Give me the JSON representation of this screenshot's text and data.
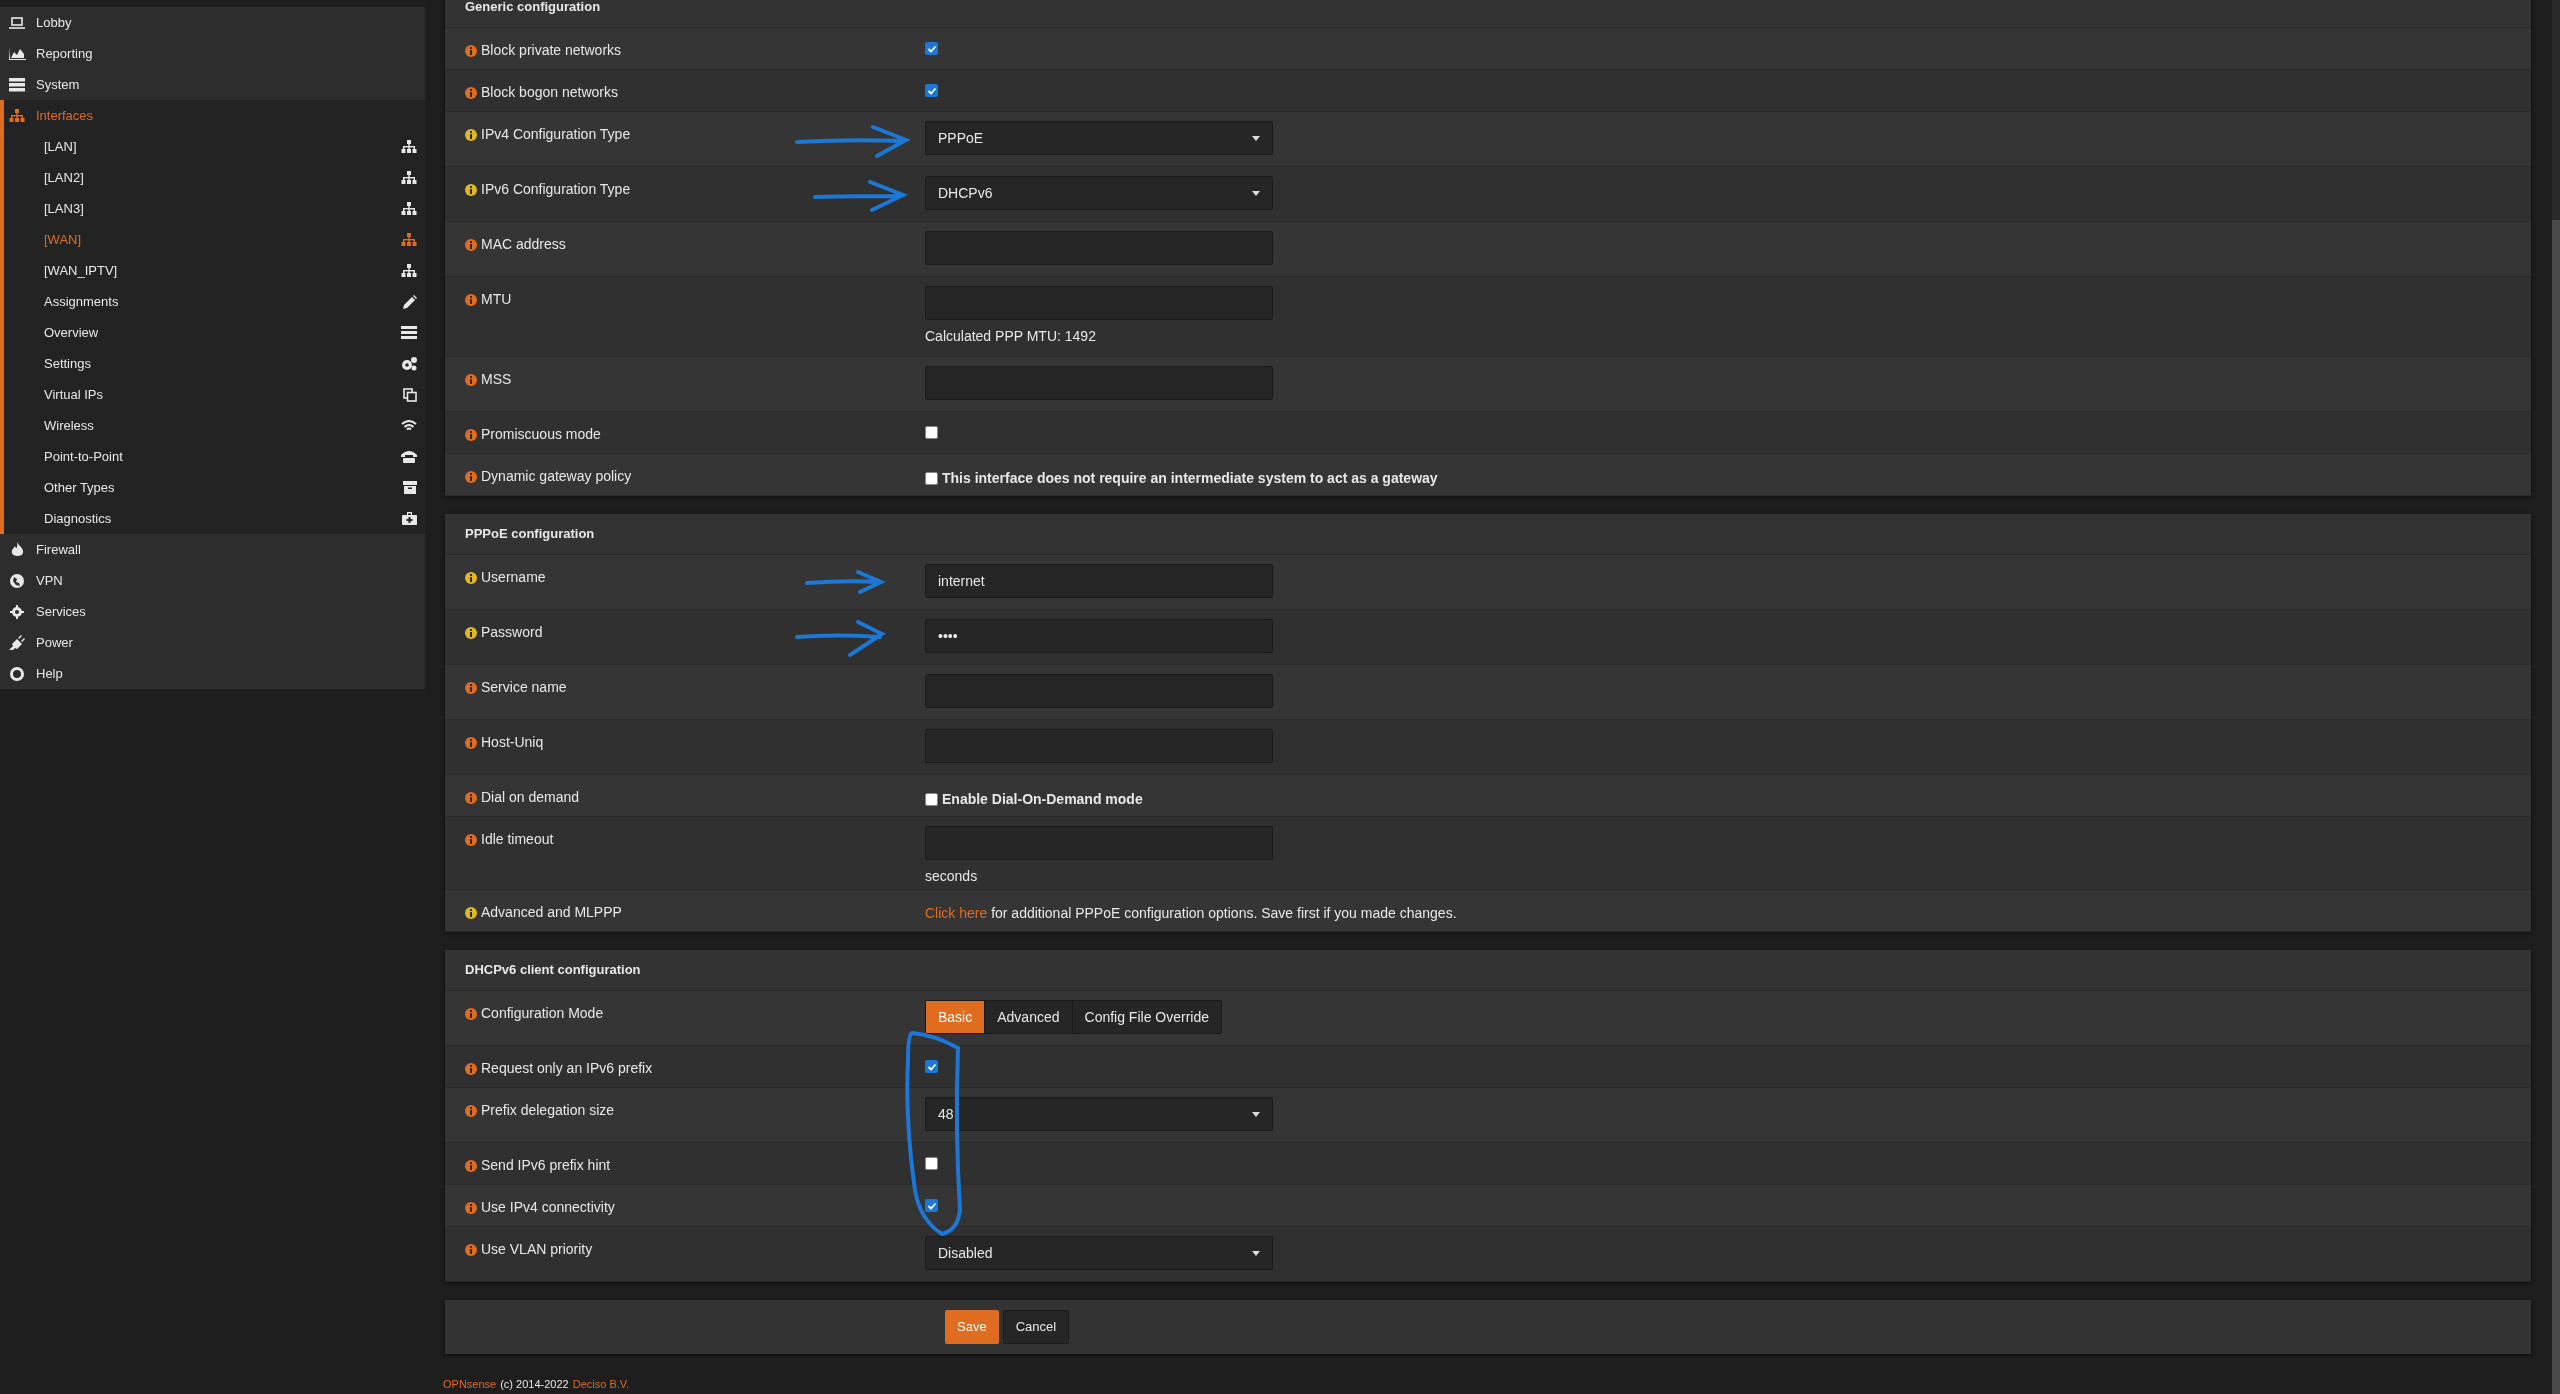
{
  "sidebar": {
    "items": [
      {
        "label": "Lobby",
        "selected": false,
        "expanded": false
      },
      {
        "label": "Reporting",
        "selected": false,
        "expanded": false
      },
      {
        "label": "System",
        "selected": false,
        "expanded": false
      },
      {
        "label": "Interfaces",
        "selected": true,
        "expanded": true,
        "children": [
          {
            "label": "[LAN]",
            "selected": false
          },
          {
            "label": "[LAN2]",
            "selected": false
          },
          {
            "label": "[LAN3]",
            "selected": false
          },
          {
            "label": "[WAN]",
            "selected": true
          },
          {
            "label": "[WAN_IPTV]",
            "selected": false
          },
          {
            "label": "Assignments",
            "selected": false
          },
          {
            "label": "Overview",
            "selected": false
          },
          {
            "label": "Settings",
            "selected": false
          },
          {
            "label": "Virtual IPs",
            "selected": false
          },
          {
            "label": "Wireless",
            "selected": false
          },
          {
            "label": "Point-to-Point",
            "selected": false
          },
          {
            "label": "Other Types",
            "selected": false
          },
          {
            "label": "Diagnostics",
            "selected": false
          }
        ]
      },
      {
        "label": "Firewall",
        "selected": false,
        "expanded": false
      },
      {
        "label": "VPN",
        "selected": false,
        "expanded": false
      },
      {
        "label": "Services",
        "selected": false,
        "expanded": false
      },
      {
        "label": "Power",
        "selected": false,
        "expanded": false
      },
      {
        "label": "Help",
        "selected": false,
        "expanded": false
      }
    ]
  },
  "sections": [
    {
      "title": "Generic configuration",
      "rows": [
        {
          "kind": "checkbox",
          "label": "Block private networks",
          "color": "#e06d1f",
          "checked": true
        },
        {
          "kind": "checkbox",
          "label": "Block bogon networks",
          "color": "#e06d1f",
          "checked": true
        },
        {
          "kind": "select",
          "label": "IPv4 Configuration Type",
          "color": "#e0b81f",
          "value": "PPPoE"
        },
        {
          "kind": "select",
          "label": "IPv6 Configuration Type",
          "color": "#e0b81f",
          "value": "DHCPv6"
        },
        {
          "kind": "text",
          "label": "MAC address",
          "color": "#e06d1f"
        },
        {
          "kind": "text",
          "label": "MTU",
          "color": "#e06d1f",
          "help": "Calculated PPP MTU: 1492"
        },
        {
          "kind": "text",
          "label": "MSS",
          "color": "#e06d1f"
        },
        {
          "kind": "checkbox",
          "label": "Promiscuous mode",
          "color": "#e06d1f",
          "checked": false
        },
        {
          "kind": "checkbox",
          "label": "Dynamic gateway policy",
          "color": "#e06d1f",
          "checked": false,
          "text": "This interface does not require an intermediate system to act as a gateway"
        }
      ]
    },
    {
      "title": "PPPoE configuration",
      "rows": [
        {
          "kind": "text",
          "label": "Username",
          "color": "#e0b81f",
          "value": "internet"
        },
        {
          "kind": "text",
          "label": "Password",
          "color": "#e0b81f",
          "value": "••••"
        },
        {
          "kind": "text",
          "label": "Service name",
          "color": "#e06d1f"
        },
        {
          "kind": "text",
          "label": "Host-Uniq",
          "color": "#e06d1f"
        },
        {
          "kind": "checkbox",
          "label": "Dial on demand",
          "color": "#e06d1f",
          "checked": false,
          "text": "Enable Dial-On-Demand mode"
        },
        {
          "kind": "text",
          "label": "Idle timeout",
          "color": "#e06d1f",
          "help": "seconds"
        },
        {
          "kind": "link",
          "label": "Advanced and MLPPP",
          "color": "#e0b81f",
          "link": "Click here",
          "text": "for additional PPPoE configuration options. Save first if you made changes."
        }
      ]
    },
    {
      "title": "DHCPv6 client configuration",
      "rows": [
        {
          "kind": "segmented",
          "label": "Configuration Mode",
          "color": "#e06d1f",
          "options": [
            {
              "label": "Basic",
              "selected": true
            },
            {
              "label": "Advanced",
              "selected": false
            },
            {
              "label": "Config File Override",
              "selected": false
            }
          ]
        },
        {
          "kind": "checkbox",
          "label": "Request only an IPv6 prefix",
          "color": "#e06d1f",
          "checked": true
        },
        {
          "kind": "select",
          "label": "Prefix delegation size",
          "color": "#e06d1f",
          "value": "48"
        },
        {
          "kind": "checkbox",
          "label": "Send IPv6 prefix hint",
          "color": "#e06d1f",
          "checked": false
        },
        {
          "kind": "checkbox",
          "label": "Use IPv4 connectivity",
          "color": "#e06d1f",
          "checked": true
        },
        {
          "kind": "select",
          "label": "Use VLAN priority",
          "color": "#e06d1f",
          "value": "Disabled"
        }
      ]
    }
  ],
  "actions": [
    "Save",
    "Cancel"
  ],
  "footer": {
    "brand": "OPNsense",
    "text": "(c) 2014-2022",
    "company": "Deciso B.V."
  }
}
